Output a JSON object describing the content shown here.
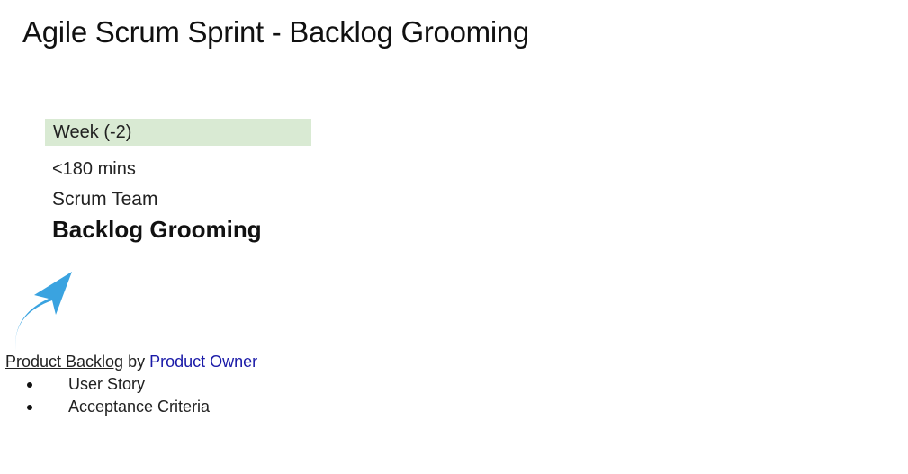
{
  "slide": {
    "title": "Agile Scrum Sprint - Backlog Grooming"
  },
  "card": {
    "week": "Week (-2)",
    "duration": "<180 mins",
    "role": "Scrum Team",
    "event": "Backlog Grooming"
  },
  "backlog": {
    "label": "Product Backlog",
    "by": "by",
    "owner": "Product Owner",
    "items": [
      "User Story",
      "Acceptance Criteria"
    ]
  },
  "colors": {
    "week_bg": "#d9ead3",
    "arrow": "#3aa3e0",
    "owner_text": "#1a1aa8"
  },
  "icons": {
    "arrow": "curved-up-arrow-icon"
  }
}
